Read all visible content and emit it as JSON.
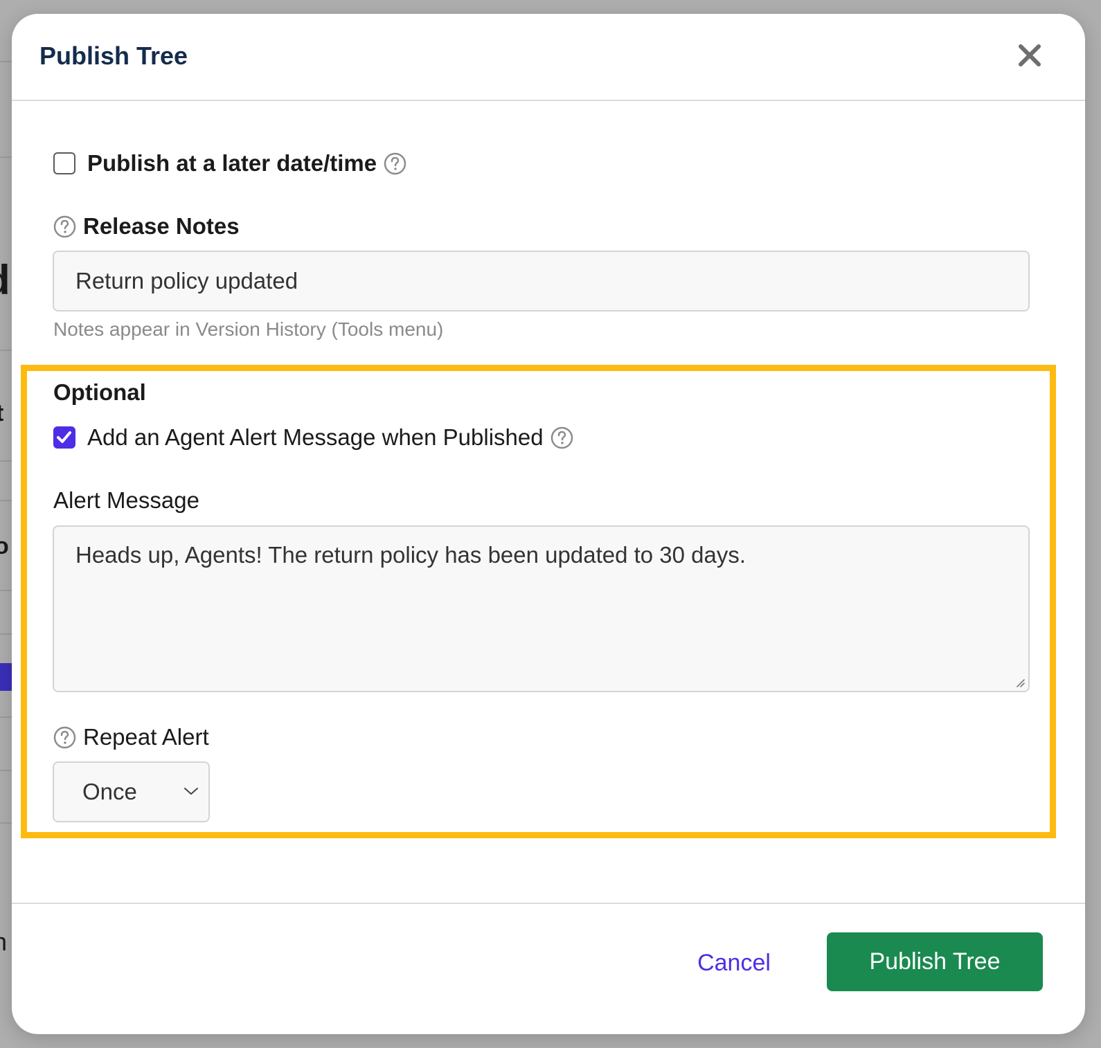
{
  "dialog": {
    "title": "Publish Tree",
    "close_icon": "close-icon"
  },
  "schedule": {
    "label": "Publish at a later date/time",
    "checked": false
  },
  "release_notes": {
    "label": "Release Notes",
    "value": "Return policy updated",
    "hint": "Notes appear in Version History (Tools menu)"
  },
  "optional": {
    "title": "Optional",
    "agent_alert": {
      "label": "Add an Agent Alert Message when Published",
      "checked": true
    },
    "alert_message": {
      "label": "Alert Message",
      "value": "Heads up, Agents! The return policy has been updated to 30 days."
    },
    "repeat_alert": {
      "label": "Repeat Alert",
      "selected": "Once"
    }
  },
  "footer": {
    "cancel_label": "Cancel",
    "publish_label": "Publish Tree"
  },
  "colors": {
    "accent": "#4f2de6",
    "primary_button": "#1a8a50",
    "highlight_border": "#fdbb11",
    "title": "#142c4c"
  }
}
